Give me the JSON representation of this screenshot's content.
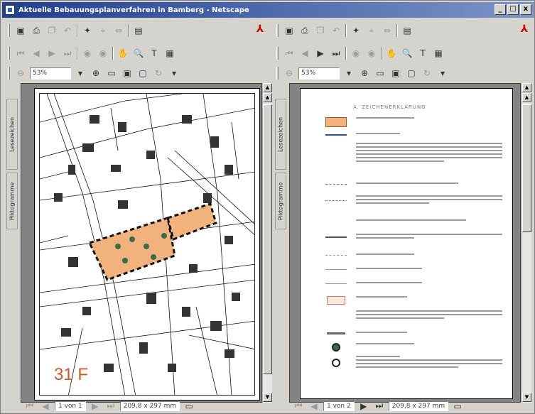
{
  "window": {
    "title": "Aktuelle Bebauungsplanverfahren in Bamberg - Netscape",
    "controls": [
      "_",
      "□",
      "x"
    ]
  },
  "left_pane": {
    "zoom": "53%",
    "side_tabs": [
      "Lesezeichen",
      "Piktogramme"
    ],
    "page_field": "1 von 1",
    "page_size": "209,8 x 297 mm",
    "sheet_label": "31 F"
  },
  "right_pane": {
    "zoom": "53%",
    "side_tabs": [
      "Lesezeichen",
      "Piktogramme"
    ],
    "page_field": "1 von 2",
    "page_size": "209,8 x 297 mm",
    "legend_title": "A. ZEICHENERKLÄRUNG"
  },
  "colors": {
    "title_start": "#1f3f8f",
    "title_end": "#7b95c8",
    "plan_fill": "#f2b27d",
    "plan_border": "#1a1a1a",
    "acrobat_red": "#d10000",
    "sheet_label": "#c9582a"
  },
  "icons": [
    "save-icon",
    "print-icon",
    "copy-icon",
    "undo-icon",
    "find-icon",
    "select-icon",
    "page-icon",
    "adobe-icon",
    "first-page-icon",
    "prev-page-icon",
    "next-page-icon",
    "last-page-icon",
    "back-icon",
    "forward-icon",
    "hand-icon",
    "zoom-icon",
    "text-select-icon",
    "graphics-select-icon",
    "zoom-out-icon",
    "actual-size-icon",
    "fit-page-icon",
    "fit-width-icon",
    "rotate-icon"
  ]
}
